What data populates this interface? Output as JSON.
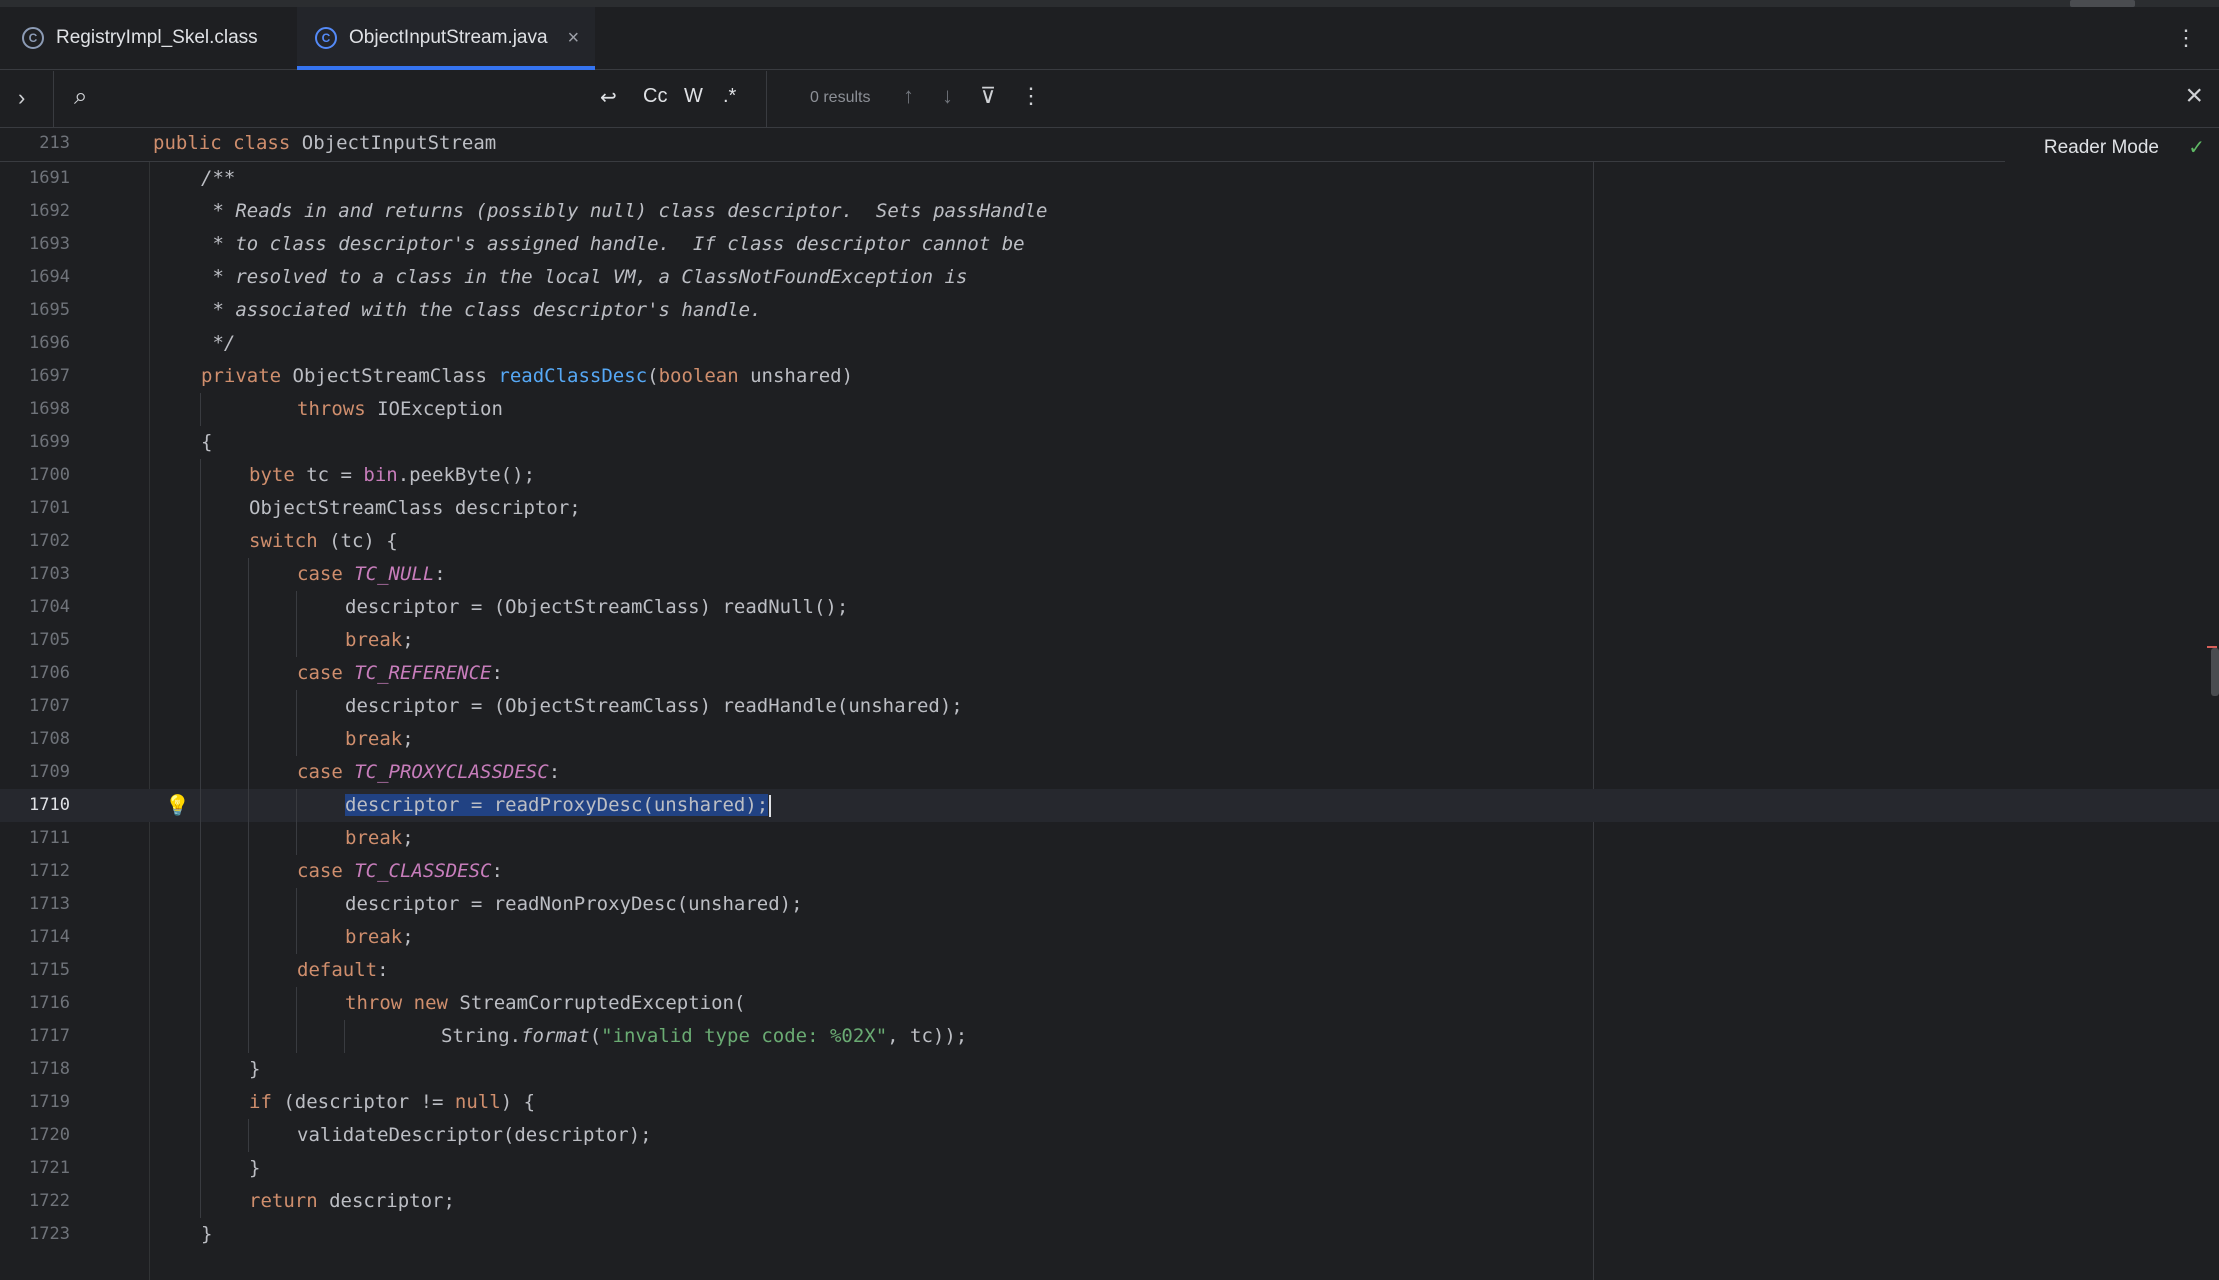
{
  "tabs": [
    {
      "label": "RegistryImpl_Skel.class",
      "icon": "class-file-icon",
      "active": false
    },
    {
      "label": "ObjectInputStream.java",
      "icon": "class-icon",
      "active": true,
      "close": "×"
    }
  ],
  "find": {
    "query": "",
    "results": "0 results",
    "options": {
      "wrap": "↩",
      "case": "Cc",
      "word": "W",
      "regex": ".*"
    }
  },
  "sticky": {
    "line": "213",
    "keyword1": "public",
    "keyword2": "class",
    "name": "ObjectInputStream"
  },
  "reader_mode": "Reader Mode",
  "colors": {
    "accent": "#3574f0",
    "keyword": "#cf8e6d",
    "comment": "#7a7e85",
    "method": "#56a8f5",
    "constant": "#c77dbb",
    "string": "#6aab73",
    "selection": "#214283"
  },
  "lines": {
    "l1691": {
      "num": "1691",
      "t": "/**"
    },
    "l1692": {
      "num": "1692",
      "t": " * Reads in and returns (possibly null) class descriptor.  Sets passHandle"
    },
    "l1693": {
      "num": "1693",
      "t": " * to class descriptor's assigned handle.  If class descriptor cannot be"
    },
    "l1694": {
      "num": "1694",
      "t": " * resolved to a class in the local VM, a ClassNotFoundException is"
    },
    "l1695": {
      "num": "1695",
      "t": " * associated with the class descriptor's handle."
    },
    "l1696": {
      "num": "1696",
      "t": " */"
    },
    "l1697": {
      "num": "1697",
      "a": "private",
      "b": " ObjectStreamClass ",
      "c": "readClassDesc",
      "d": "(",
      "e": "boolean",
      "f": " unshared)"
    },
    "l1698": {
      "num": "1698",
      "a": "throws",
      "b": " IOException"
    },
    "l1699": {
      "num": "1699",
      "t": "{"
    },
    "l1700": {
      "num": "1700",
      "a": "byte",
      "b": " tc = ",
      "c": "bin",
      "d": ".peekByte();"
    },
    "l1701": {
      "num": "1701",
      "t": "ObjectStreamClass descriptor;"
    },
    "l1702": {
      "num": "1702",
      "a": "switch",
      "b": " (tc) {"
    },
    "l1703": {
      "num": "1703",
      "a": "case",
      "b": "TC_NULL",
      "c": ":"
    },
    "l1704": {
      "num": "1704",
      "t": "descriptor = (ObjectStreamClass) readNull();"
    },
    "l1705": {
      "num": "1705",
      "a": "break",
      "b": ";"
    },
    "l1706": {
      "num": "1706",
      "a": "case",
      "b": "TC_REFERENCE",
      "c": ":"
    },
    "l1707": {
      "num": "1707",
      "t": "descriptor = (ObjectStreamClass) readHandle(unshared);"
    },
    "l1708": {
      "num": "1708",
      "a": "break",
      "b": ";"
    },
    "l1709": {
      "num": "1709",
      "a": "case",
      "b": "TC_PROXYCLASSDESC",
      "c": ":"
    },
    "l1710": {
      "num": "1710",
      "t": "descriptor = readProxyDesc(unshared);"
    },
    "l1711": {
      "num": "1711",
      "a": "break",
      "b": ";"
    },
    "l1712": {
      "num": "1712",
      "a": "case",
      "b": "TC_CLASSDESC",
      "c": ":"
    },
    "l1713": {
      "num": "1713",
      "t": "descriptor = readNonProxyDesc(unshared);"
    },
    "l1714": {
      "num": "1714",
      "a": "break",
      "b": ";"
    },
    "l1715": {
      "num": "1715",
      "a": "default",
      "b": ":"
    },
    "l1716": {
      "num": "1716",
      "a": "throw",
      "b": "new",
      "c": " StreamCorruptedException("
    },
    "l1717": {
      "num": "1717",
      "a": "String.",
      "b": "format",
      "c": "(",
      "d": "\"invalid type code: %02X\"",
      "e": ", tc));"
    },
    "l1718": {
      "num": "1718",
      "t": "}"
    },
    "l1719": {
      "num": "1719",
      "a": "if",
      "b": " (descriptor != ",
      "c": "null",
      "d": ") {"
    },
    "l1720": {
      "num": "1720",
      "t": "validateDescriptor(descriptor);"
    },
    "l1721": {
      "num": "1721",
      "t": "}"
    },
    "l1722": {
      "num": "1722",
      "a": "return",
      "b": " descriptor;"
    },
    "l1723": {
      "num": "1723",
      "t": "}"
    }
  }
}
